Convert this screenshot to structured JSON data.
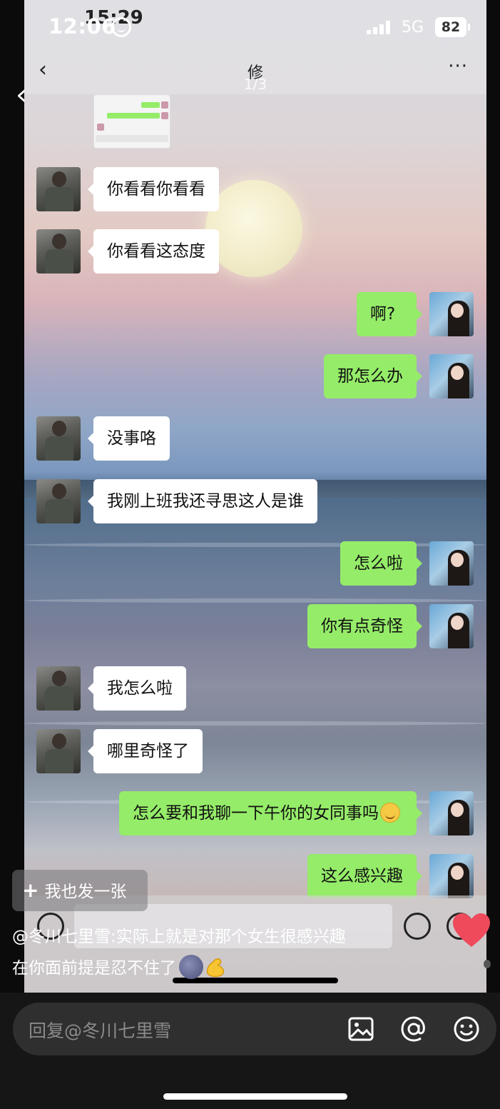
{
  "status_bar": {
    "time": "12:06",
    "ghost_time": "15:29",
    "network": "5G",
    "battery": "82"
  },
  "chat": {
    "title": "修",
    "page_indicator": "1/3",
    "messages": [
      {
        "side": "left",
        "text": "你看看你看看"
      },
      {
        "side": "left",
        "text": "你看看这态度"
      },
      {
        "side": "right",
        "text": "啊?"
      },
      {
        "side": "right",
        "text": "那怎么办"
      },
      {
        "side": "left",
        "text": "没事咯"
      },
      {
        "side": "left",
        "text": "我刚上班我还寻思这人是谁"
      },
      {
        "side": "right",
        "text": "怎么啦"
      },
      {
        "side": "right",
        "text": "你有点奇怪"
      },
      {
        "side": "left",
        "text": "我怎么啦"
      },
      {
        "side": "left",
        "text": "哪里奇怪了"
      },
      {
        "side": "right",
        "text": "怎么要和我聊一下午你的女同事吗",
        "emoji": "smile"
      },
      {
        "side": "right",
        "text": "这么感兴趣"
      }
    ]
  },
  "post": {
    "also_post_label": "我也发一张",
    "caption_line1": "@冬川七里雪:实际上就是对那个女生很感兴趣",
    "caption_line2": "在你面前提是忍不住了"
  },
  "reply": {
    "placeholder": "回复@冬川七里雪"
  },
  "icons": [
    "face-id-icon",
    "back-icon",
    "more-icon",
    "heart-icon",
    "image-icon",
    "at-icon",
    "emoji-icon"
  ],
  "colors": {
    "bubble_green": "#95ec69",
    "bubble_white": "#ffffff",
    "reply_bg": "#2f2f2f"
  }
}
